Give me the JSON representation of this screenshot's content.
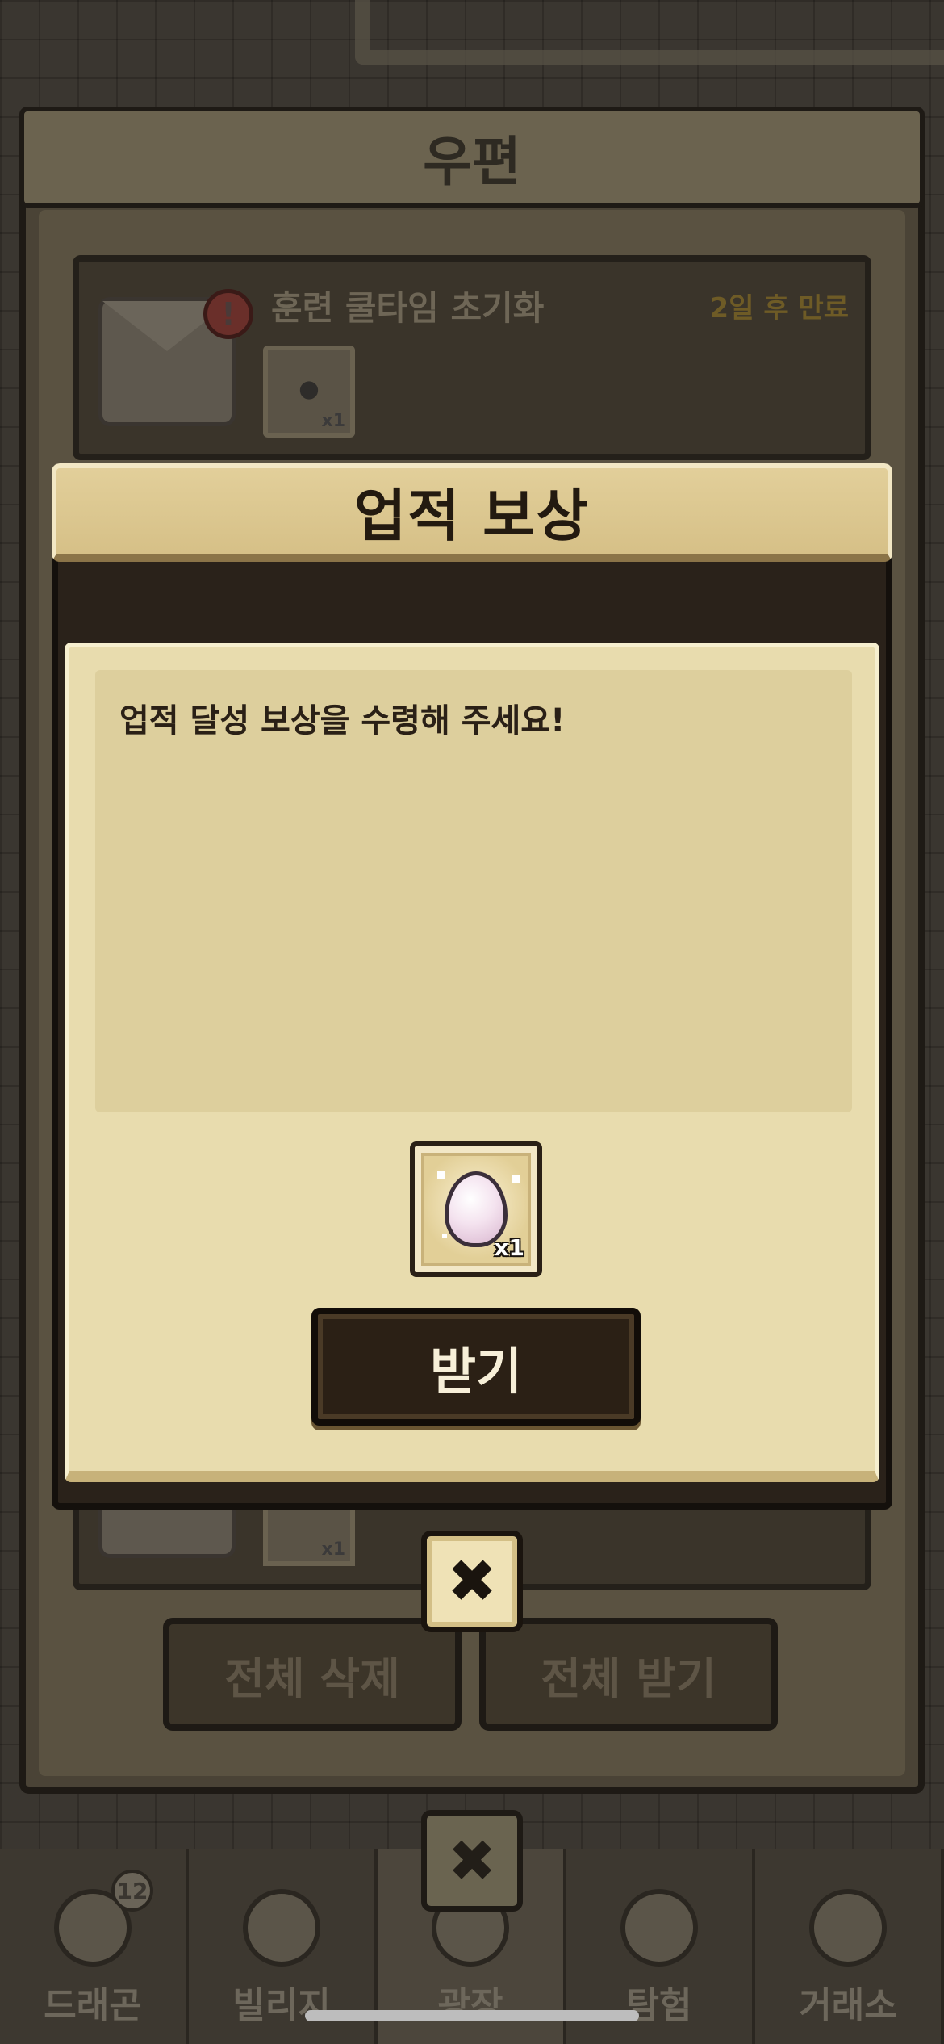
{
  "bottom_nav": {
    "items": [
      {
        "label": "드래곤",
        "badge": "12"
      },
      {
        "label": "빌리지"
      },
      {
        "label": "광장"
      },
      {
        "label": "탐험"
      },
      {
        "label": "거래소"
      }
    ]
  },
  "mail": {
    "title": "우편",
    "item": {
      "title": "훈련 쿨타임 초기화",
      "expire": "2일 후 만료",
      "alert": "!",
      "reward_qty": "x1"
    },
    "item2": {
      "reward_qty": "x1"
    },
    "delete_all": "전체 삭제",
    "receive_all": "전체 받기",
    "close_glyph": "✖"
  },
  "popup": {
    "title": "업적 보상",
    "message": "업적 달성 보상을 수령해 주세요!",
    "reward": {
      "icon": "egg-icon",
      "qty": "x1"
    },
    "receive_label": "받기",
    "close_glyph": "✖"
  },
  "colors": {
    "popup_header": "#d6c087",
    "popup_body": "#e8dcae",
    "button_dark": "#2b2015",
    "dim_background": "#2c2720"
  }
}
